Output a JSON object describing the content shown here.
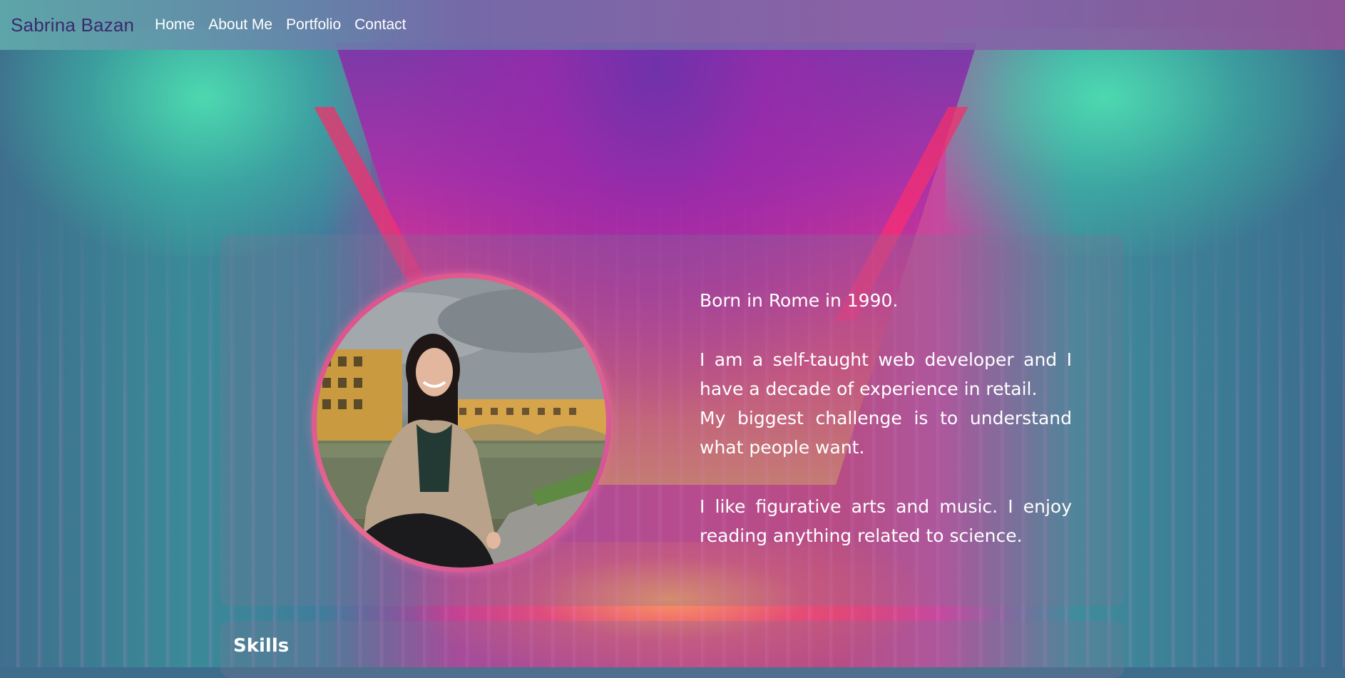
{
  "navbar": {
    "brand": "Sabrina Bazan",
    "links": [
      "Home",
      "About Me",
      "Portfolio",
      "Contact"
    ]
  },
  "about": {
    "photo_icon": "profile-photo",
    "paragraphs": [
      "Born in Rome in 1990.",
      "I am a self-taught web developer and I have a decade of experience in retail.",
      "My biggest challenge is to understand what people want.",
      "I like figurative arts and music. I enjoy reading anything related to science."
    ]
  },
  "skills": {
    "title": "Skills"
  },
  "colors": {
    "brand_text": "#3b2a6e",
    "nav_text": "#ffffff",
    "photo_ring": "#d94a8e"
  }
}
